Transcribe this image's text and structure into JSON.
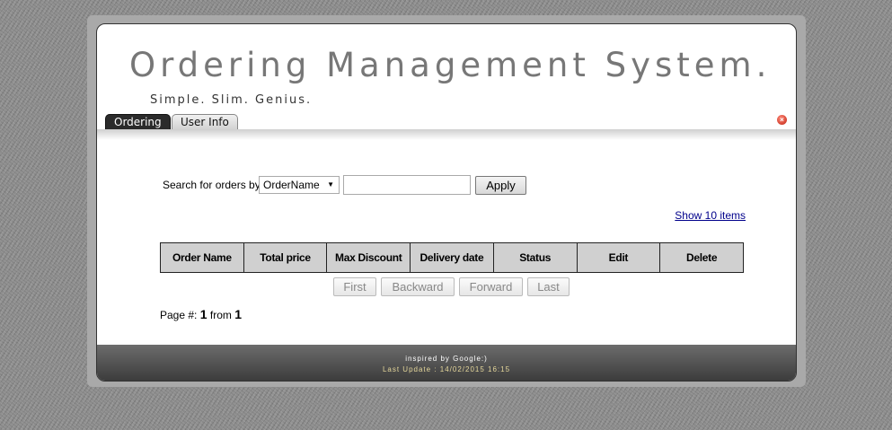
{
  "header": {
    "title": "Ordering Management System.",
    "slogan": "Simple. Slim. Genius."
  },
  "tabs": [
    {
      "label": "Ordering",
      "active": true
    },
    {
      "label": "User Info",
      "active": false
    }
  ],
  "close_icon": "close-icon",
  "search": {
    "label": "Search for orders by:",
    "field_selected": "OrderName",
    "input_value": "",
    "apply_label": "Apply"
  },
  "show_items_label": "Show 10 items",
  "table": {
    "columns": [
      "Order Name",
      "Total price",
      "Max Discount",
      "Delivery date",
      "Status",
      "Edit",
      "Delete"
    ],
    "rows": []
  },
  "pager": {
    "first": "First",
    "backward": "Backward",
    "forward": "Forward",
    "last": "Last"
  },
  "page_info": {
    "prefix": "Page #:",
    "current": "1",
    "from_label": "from",
    "total": "1"
  },
  "footer": {
    "line1": "inspired by Google:)",
    "line2": "Last Update : 14/02/2015 16:15"
  },
  "colors": {
    "active_tab": "#2b2b2b",
    "table_header": "#d0d0d0",
    "footer_bg": "#4a4a4a",
    "footer_update_text": "#e4d69a",
    "link": "#00008b"
  }
}
